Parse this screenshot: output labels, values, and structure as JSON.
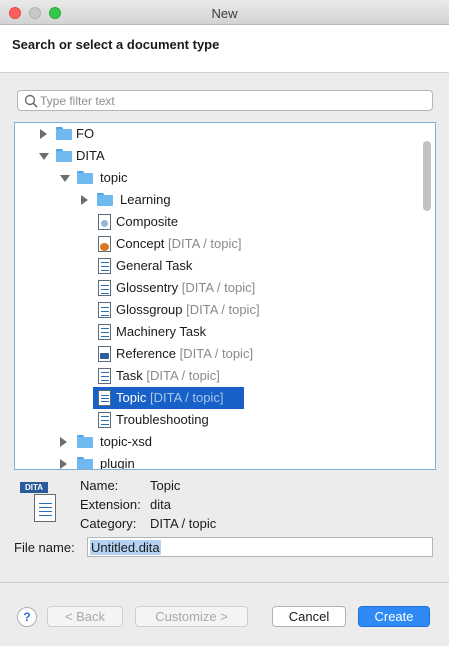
{
  "window": {
    "title": "New"
  },
  "header": {
    "title": "Search or select a document type"
  },
  "filter": {
    "placeholder": "Type filter text"
  },
  "tree": [
    {
      "label": "FO",
      "category": ""
    },
    {
      "label": "DITA",
      "category": ""
    },
    {
      "label": "topic",
      "category": ""
    },
    {
      "label": "Learning",
      "category": ""
    },
    {
      "label": "Composite",
      "category": ""
    },
    {
      "label": "Concept",
      "category": "[DITA / topic]"
    },
    {
      "label": "General Task",
      "category": ""
    },
    {
      "label": "Glossentry",
      "category": "[DITA / topic]"
    },
    {
      "label": "Glossgroup",
      "category": "[DITA / topic]"
    },
    {
      "label": "Machinery Task",
      "category": ""
    },
    {
      "label": "Reference",
      "category": "[DITA / topic]"
    },
    {
      "label": "Task",
      "category": "[DITA / topic]"
    },
    {
      "label": "Topic",
      "category": "[DITA / topic]"
    },
    {
      "label": "Troubleshooting",
      "category": ""
    },
    {
      "label": "topic-xsd",
      "category": ""
    },
    {
      "label": "plugin",
      "category": ""
    }
  ],
  "info": {
    "badge": "DITA",
    "name_label": "Name:",
    "name_value": "Topic",
    "extension_label": "Extension:",
    "extension_value": "dita",
    "category_label": "Category:",
    "category_value": "DITA / topic"
  },
  "file_name": {
    "label": "File name:",
    "value": "Untitled.dita"
  },
  "buttons": {
    "help": "?",
    "back": "< Back",
    "customize": "Customize >",
    "cancel": "Cancel",
    "create": "Create"
  },
  "colors": {
    "selection": "#1660c8",
    "primary": "#2f8af5",
    "folder": "#6fb9f0"
  }
}
